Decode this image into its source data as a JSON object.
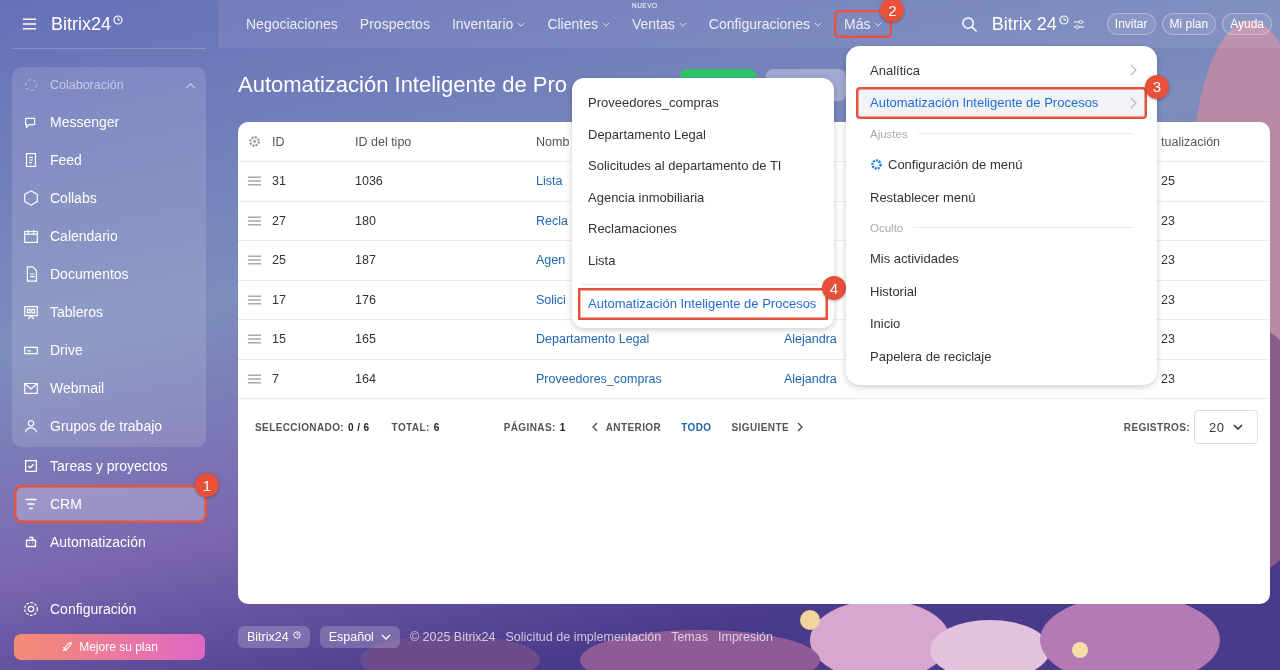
{
  "sidebar": {
    "logo": "Bitrix24",
    "group": {
      "label": "Colaboración",
      "expanded": true,
      "items": [
        {
          "label": "Messenger",
          "selected": false
        },
        {
          "label": "Feed",
          "selected": false
        },
        {
          "label": "Collabs",
          "selected": false
        },
        {
          "label": "Calendario",
          "selected": false
        },
        {
          "label": "Documentos",
          "selected": false
        },
        {
          "label": "Tableros",
          "selected": false
        },
        {
          "label": "Drive",
          "selected": false
        },
        {
          "label": "Webmail",
          "selected": false
        },
        {
          "label": "Grupos de trabajo",
          "selected": false
        }
      ]
    },
    "items": [
      {
        "label": "Tareas y proyectos",
        "selected": false
      },
      {
        "label": "CRM",
        "selected": true,
        "callout": "1"
      },
      {
        "label": "Automatización",
        "selected": false
      }
    ],
    "settings": "Configuración",
    "upgrade_button": "Mejore su plan"
  },
  "topbar": {
    "nav": [
      {
        "label": "Negociaciones",
        "dropdown": false
      },
      {
        "label": "Prospectos",
        "dropdown": false
      },
      {
        "label": "Inventario",
        "dropdown": true
      },
      {
        "label": "Clientes",
        "dropdown": true
      },
      {
        "label": "Ventas",
        "dropdown": true,
        "tag": "NUEVO"
      },
      {
        "label": "Configuraciones",
        "dropdown": true
      },
      {
        "label": "Más",
        "dropdown": true,
        "callout": "2"
      }
    ],
    "logo": "Bitrix 24",
    "buttons": [
      "Invitar",
      "Mi plan",
      "Ayuda"
    ]
  },
  "page": {
    "title": "Automatización Inteligente de Pro"
  },
  "table": {
    "columns": {
      "id": "ID",
      "type_id": "ID del tipo",
      "name": "Nomb",
      "column_6": "tualización"
    },
    "rows": [
      {
        "id": "31",
        "type_id": "1036",
        "name": "Lista",
        "column_6": "25"
      },
      {
        "id": "27",
        "type_id": "180",
        "name": "Recla",
        "column_6": "23"
      },
      {
        "id": "25",
        "type_id": "187",
        "name": "Agen",
        "column_6": "23"
      },
      {
        "id": "17",
        "type_id": "176",
        "name": "Solici",
        "column_6": "23"
      },
      {
        "id": "15",
        "type_id": "165",
        "name": "Departamento Legal",
        "column_5": "Alejandra",
        "column_6": "23"
      },
      {
        "id": "7",
        "type_id": "164",
        "name": "Proveedores_compras",
        "column_5": "Alejandra",
        "column_6": "23"
      }
    ],
    "footer": {
      "selected_label": "SELECCIONADO:",
      "selected": "0 / 6",
      "total_label": "TOTAL:",
      "total": "6",
      "pages_label": "PÁGINAS:",
      "pages": "1",
      "prev": "ANTERIOR",
      "all": "TODO",
      "next": "SIGUIENTE",
      "records_label": "REGISTROS:",
      "records": "20"
    }
  },
  "submenu": {
    "items": [
      {
        "kind": "item",
        "label": "Proveedores_compras"
      },
      {
        "kind": "item",
        "label": "Departamento Legal"
      },
      {
        "kind": "item",
        "label": "Solicitudes al departamento de TI"
      },
      {
        "kind": "item",
        "label": "Agencia inmobiliaria"
      },
      {
        "kind": "item",
        "label": "Reclamaciones"
      },
      {
        "kind": "item",
        "label": "Lista"
      },
      {
        "kind": "action",
        "label": "Automatización Inteligente de Procesos",
        "callout": "4"
      }
    ]
  },
  "more_menu": {
    "items": [
      {
        "kind": "item",
        "label": "Analítica",
        "submenu": true,
        "selected": false
      },
      {
        "kind": "item",
        "label": "Automatización Inteligente de Procesos",
        "submenu": true,
        "selected": true,
        "callout": "3"
      },
      {
        "kind": "section",
        "label": "Ajustes"
      },
      {
        "kind": "settings",
        "label": "Configuración de menú"
      },
      {
        "kind": "item",
        "label": "Restablecer menú",
        "submenu": false,
        "selected": false
      },
      {
        "kind": "section",
        "label": "Oculto"
      },
      {
        "kind": "item",
        "label": "Mis actividades",
        "submenu": false,
        "selected": false
      },
      {
        "kind": "item",
        "label": "Historial",
        "submenu": false,
        "selected": false
      },
      {
        "kind": "item",
        "label": "Inicio",
        "submenu": false,
        "selected": false
      },
      {
        "kind": "item",
        "label": "Papelera de reciclaje",
        "submenu": false,
        "selected": false
      }
    ]
  },
  "footer": {
    "brand": "Bitrix24",
    "language": "Español",
    "copyright": "© 2025 Bitrix24",
    "links": [
      "Solicitud de implementación",
      "Temas",
      "Impresión"
    ]
  }
}
